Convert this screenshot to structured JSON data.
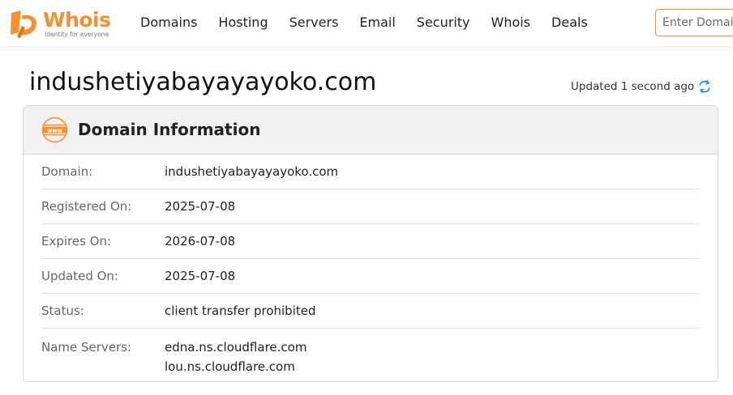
{
  "brand": {
    "name": "Whois",
    "tagline": "Identity for everyone",
    "accent_color": "#f6902e"
  },
  "nav": {
    "links": [
      "Domains",
      "Hosting",
      "Servers",
      "Email",
      "Security",
      "Whois",
      "Deals"
    ]
  },
  "search": {
    "placeholder": "Enter Domain or IP"
  },
  "page": {
    "domain": "indushetiyabayayayoko.com",
    "updated_text": "Updated 1 second ago"
  },
  "domain_info": {
    "title": "Domain Information",
    "icon": "www-icon",
    "rows": [
      {
        "label": "Domain:",
        "value": "indushetiyabayayayoko.com"
      },
      {
        "label": "Registered On:",
        "value": "2025-07-08"
      },
      {
        "label": "Expires On:",
        "value": "2026-07-08"
      },
      {
        "label": "Updated On:",
        "value": "2025-07-08"
      },
      {
        "label": "Status:",
        "value": "client transfer prohibited"
      },
      {
        "label": "Name Servers:",
        "values": [
          "edna.ns.cloudflare.com",
          "lou.ns.cloudflare.com"
        ]
      }
    ]
  }
}
